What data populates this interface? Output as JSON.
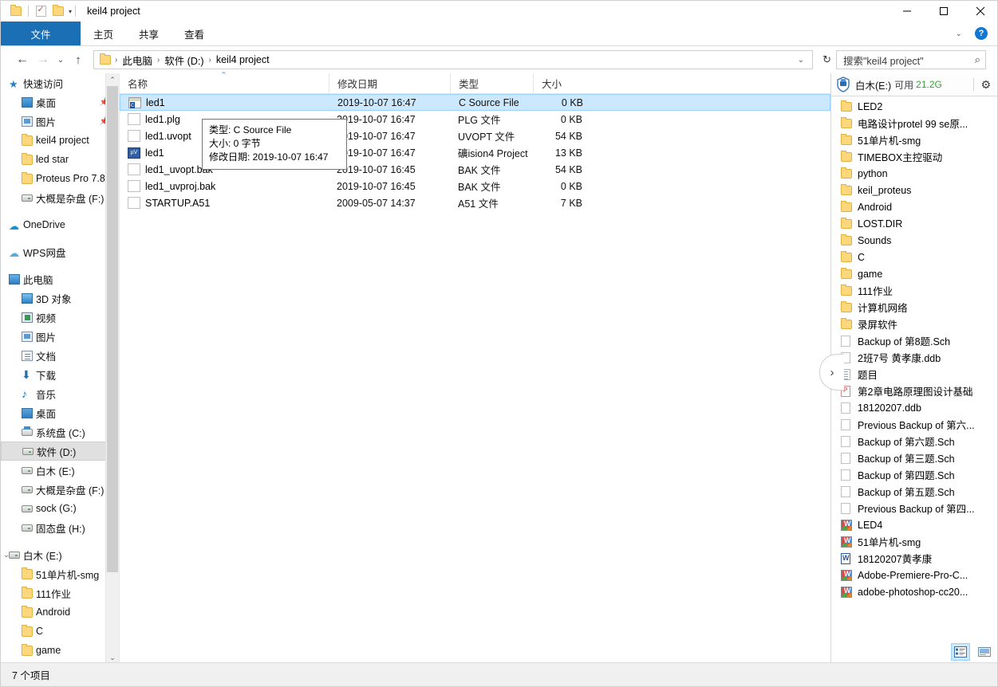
{
  "window": {
    "title": "keil4 project",
    "quick_access": [
      "folder-icon",
      "properties-icon",
      "new-folder-icon",
      "customize-caret"
    ],
    "controls": {
      "minimize": "—",
      "maximize": "□",
      "close": "✕"
    }
  },
  "ribbon": {
    "tabs": [
      {
        "label": "文件",
        "active": true
      },
      {
        "label": "主页",
        "active": false
      },
      {
        "label": "共享",
        "active": false
      },
      {
        "label": "查看",
        "active": false
      }
    ],
    "expand_caret": "⌄",
    "help_label": "?"
  },
  "address": {
    "back": "←",
    "forward": "→",
    "history": "⌄",
    "up": "↑",
    "crumbs": [
      "此电脑",
      "软件 (D:)",
      "keil4 project"
    ],
    "crumb_separator": "›",
    "dropdown_caret": "⌄",
    "refresh": "↻"
  },
  "search": {
    "placeholder": "搜索\"keil4 project\"",
    "icon": "search-icon"
  },
  "sidebar": {
    "items": [
      {
        "label": "快速访问",
        "icon": "star",
        "indent": 0,
        "pinned": false,
        "selected": false,
        "expander": ""
      },
      {
        "label": "桌面",
        "icon": "desktop",
        "indent": 1,
        "pinned": true,
        "selected": false,
        "expander": ""
      },
      {
        "label": "图片",
        "icon": "pictures",
        "indent": 1,
        "pinned": true,
        "selected": false,
        "expander": ""
      },
      {
        "label": "keil4 project",
        "icon": "folder",
        "indent": 1,
        "pinned": false,
        "selected": false,
        "expander": ""
      },
      {
        "label": "led star",
        "icon": "folder",
        "indent": 1,
        "pinned": false,
        "selected": false,
        "expander": ""
      },
      {
        "label": "Proteus Pro 7.8",
        "icon": "folder",
        "indent": 1,
        "pinned": false,
        "selected": false,
        "expander": ""
      },
      {
        "label": "大概是杂盘 (F:)",
        "icon": "drive",
        "indent": 1,
        "pinned": false,
        "selected": false,
        "expander": ""
      },
      {
        "label": "",
        "icon": "gap",
        "indent": 0,
        "pinned": false,
        "selected": false,
        "expander": ""
      },
      {
        "label": "OneDrive",
        "icon": "onedrive",
        "indent": 0,
        "pinned": false,
        "selected": false,
        "expander": ""
      },
      {
        "label": "",
        "icon": "gap",
        "indent": 0,
        "pinned": false,
        "selected": false,
        "expander": ""
      },
      {
        "label": "WPS网盘",
        "icon": "wps",
        "indent": 0,
        "pinned": false,
        "selected": false,
        "expander": ""
      },
      {
        "label": "",
        "icon": "gap",
        "indent": 0,
        "pinned": false,
        "selected": false,
        "expander": ""
      },
      {
        "label": "此电脑",
        "icon": "pc",
        "indent": 0,
        "pinned": false,
        "selected": false,
        "expander": ""
      },
      {
        "label": "3D 对象",
        "icon": "obj3d",
        "indent": 1,
        "pinned": false,
        "selected": false,
        "expander": ""
      },
      {
        "label": "视频",
        "icon": "video",
        "indent": 1,
        "pinned": false,
        "selected": false,
        "expander": ""
      },
      {
        "label": "图片",
        "icon": "pictures",
        "indent": 1,
        "pinned": false,
        "selected": false,
        "expander": ""
      },
      {
        "label": "文档",
        "icon": "doc",
        "indent": 1,
        "pinned": false,
        "selected": false,
        "expander": ""
      },
      {
        "label": "下载",
        "icon": "download",
        "indent": 1,
        "pinned": false,
        "selected": false,
        "expander": ""
      },
      {
        "label": "音乐",
        "icon": "music",
        "indent": 1,
        "pinned": false,
        "selected": false,
        "expander": ""
      },
      {
        "label": "桌面",
        "icon": "desktop",
        "indent": 1,
        "pinned": false,
        "selected": false,
        "expander": ""
      },
      {
        "label": "系统盘 (C:)",
        "icon": "sysdrive",
        "indent": 1,
        "pinned": false,
        "selected": false,
        "expander": ""
      },
      {
        "label": "软件 (D:)",
        "icon": "drive",
        "indent": 1,
        "pinned": false,
        "selected": true,
        "expander": ""
      },
      {
        "label": "白木 (E:)",
        "icon": "drive",
        "indent": 1,
        "pinned": false,
        "selected": false,
        "expander": ""
      },
      {
        "label": "大概是杂盘 (F:)",
        "icon": "drive",
        "indent": 1,
        "pinned": false,
        "selected": false,
        "expander": ""
      },
      {
        "label": "sock (G:)",
        "icon": "drive",
        "indent": 1,
        "pinned": false,
        "selected": false,
        "expander": ""
      },
      {
        "label": "固态盘 (H:)",
        "icon": "drive",
        "indent": 1,
        "pinned": false,
        "selected": false,
        "expander": ""
      },
      {
        "label": "",
        "icon": "gap",
        "indent": 0,
        "pinned": false,
        "selected": false,
        "expander": ""
      },
      {
        "label": "白木 (E:)",
        "icon": "drive",
        "indent": 0,
        "pinned": false,
        "selected": false,
        "expander": "⌄"
      },
      {
        "label": "51单片机-smg",
        "icon": "folder",
        "indent": 1,
        "pinned": false,
        "selected": false,
        "expander": ""
      },
      {
        "label": "111作业",
        "icon": "folder",
        "indent": 1,
        "pinned": false,
        "selected": false,
        "expander": ""
      },
      {
        "label": "Android",
        "icon": "folder",
        "indent": 1,
        "pinned": false,
        "selected": false,
        "expander": ""
      },
      {
        "label": "C",
        "icon": "folder",
        "indent": 1,
        "pinned": false,
        "selected": false,
        "expander": ""
      },
      {
        "label": "game",
        "icon": "folder",
        "indent": 1,
        "pinned": false,
        "selected": false,
        "expander": ""
      }
    ],
    "scroll_up": "⌃",
    "scroll_down": "⌄"
  },
  "filelist": {
    "columns": [
      {
        "label": "名称",
        "key": "name"
      },
      {
        "label": "修改日期",
        "key": "date"
      },
      {
        "label": "类型",
        "key": "type"
      },
      {
        "label": "大小",
        "key": "size"
      }
    ],
    "sort_indicator": "⌃",
    "rows": [
      {
        "name": "led1",
        "date": "2019-10-07 16:47",
        "type": "C Source File",
        "size": "0 KB",
        "icon": "c-source-icon",
        "selected": true
      },
      {
        "name": "led1.plg",
        "date": "2019-10-07 16:47",
        "type": "PLG 文件",
        "size": "0 KB",
        "icon": "blank-file-icon",
        "selected": false
      },
      {
        "name": "led1.uvopt",
        "date": "2019-10-07 16:47",
        "type": "UVOPT 文件",
        "size": "54 KB",
        "icon": "blank-file-icon",
        "selected": false
      },
      {
        "name": "led1",
        "date": "2019-10-07 16:47",
        "type": "礦ision4 Project",
        "size": "13 KB",
        "icon": "uvision-icon",
        "selected": false
      },
      {
        "name": "led1_uvopt.bak",
        "date": "2019-10-07 16:45",
        "type": "BAK 文件",
        "size": "54 KB",
        "icon": "blank-file-icon",
        "selected": false
      },
      {
        "name": "led1_uvproj.bak",
        "date": "2019-10-07 16:45",
        "type": "BAK 文件",
        "size": "0 KB",
        "icon": "blank-file-icon",
        "selected": false
      },
      {
        "name": "STARTUP.A51",
        "date": "2009-05-07 14:37",
        "type": "A51 文件",
        "size": "7 KB",
        "icon": "blank-file-icon",
        "selected": false
      }
    ]
  },
  "tooltip": {
    "line1": "类型: C Source File",
    "line2": "大小: 0 字节",
    "line3": "修改日期: 2019-10-07 16:47"
  },
  "rightpane": {
    "drive_name": "白木(E:)",
    "avail_label": "可用",
    "avail_size": "21.2G",
    "avail_color": "#3aa13a",
    "gear": "⚙",
    "collapse_arrow": "›",
    "items": [
      {
        "label": "LED2",
        "icon": "folder"
      },
      {
        "label": "电路设计protel 99 se原...",
        "icon": "folder"
      },
      {
        "label": "51单片机-smg",
        "icon": "folder"
      },
      {
        "label": "TIMEBOX主控驱动",
        "icon": "folder"
      },
      {
        "label": "python",
        "icon": "folder"
      },
      {
        "label": "keil_proteus",
        "icon": "folder"
      },
      {
        "label": "Android",
        "icon": "folder"
      },
      {
        "label": "LOST.DIR",
        "icon": "folder"
      },
      {
        "label": "Sounds",
        "icon": "folder"
      },
      {
        "label": "C",
        "icon": "folder"
      },
      {
        "label": "game",
        "icon": "folder"
      },
      {
        "label": "111作业",
        "icon": "folder"
      },
      {
        "label": "计算机网络",
        "icon": "folder"
      },
      {
        "label": "录屏软件",
        "icon": "folder"
      },
      {
        "label": "Backup of 第8题.Sch",
        "icon": "file"
      },
      {
        "label": "2班7号 黄孝康.ddb",
        "icon": "file"
      },
      {
        "label": "题目",
        "icon": "txt"
      },
      {
        "label": "第2章电路原理图设计基础",
        "icon": "pdf"
      },
      {
        "label": "18120207.ddb",
        "icon": "file"
      },
      {
        "label": "Previous Backup of 第六...",
        "icon": "file"
      },
      {
        "label": "Backup of 第六题.Sch",
        "icon": "file"
      },
      {
        "label": "Backup of 第三题.Sch",
        "icon": "file"
      },
      {
        "label": "Backup of 第四题.Sch",
        "icon": "file"
      },
      {
        "label": "Backup of 第五题.Sch",
        "icon": "file"
      },
      {
        "label": "Previous Backup of 第四...",
        "icon": "file"
      },
      {
        "label": "LED4",
        "icon": "exe"
      },
      {
        "label": "51单片机-smg",
        "icon": "exe"
      },
      {
        "label": "18120207黄孝康",
        "icon": "word"
      },
      {
        "label": "Adobe-Premiere-Pro-C...",
        "icon": "exe"
      },
      {
        "label": "adobe-photoshop-cc20...",
        "icon": "exe"
      }
    ],
    "view_buttons": [
      {
        "name": "details-view",
        "glyph": "▤",
        "active": true
      },
      {
        "name": "large-icons-view",
        "glyph": "▭",
        "active": false
      }
    ]
  },
  "statusbar": {
    "item_count": "7 个项目"
  }
}
